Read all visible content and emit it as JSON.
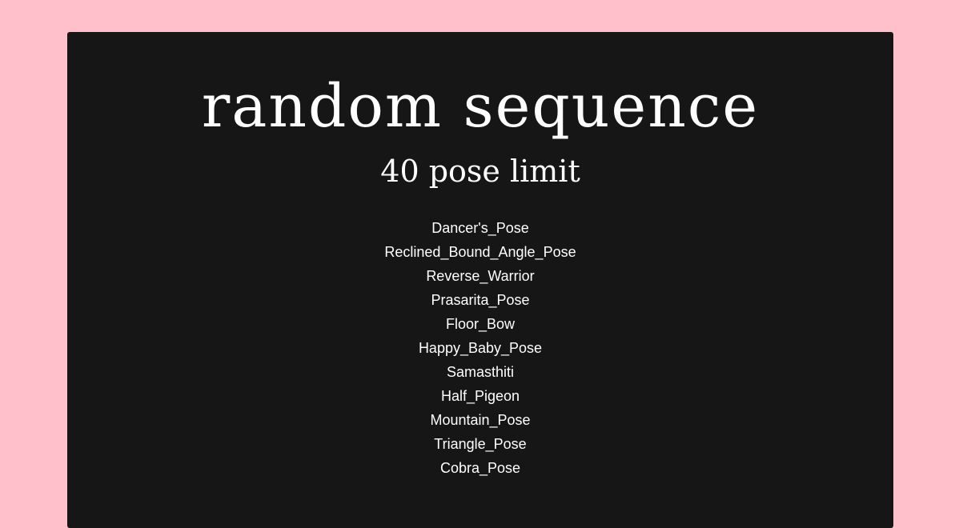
{
  "page": {
    "background_color": "#ffbfcb",
    "card_color": "#161616",
    "text_color": "#ffffff",
    "title": "random sequence",
    "subtitle": "40 pose limit"
  },
  "poses": [
    "Dancer's_Pose",
    "Reclined_Bound_Angle_Pose",
    "Reverse_Warrior",
    "Prasarita_Pose",
    "Floor_Bow",
    "Happy_Baby_Pose",
    "Samasthiti",
    "Half_Pigeon",
    "Mountain_Pose",
    "Triangle_Pose",
    "Cobra_Pose"
  ]
}
